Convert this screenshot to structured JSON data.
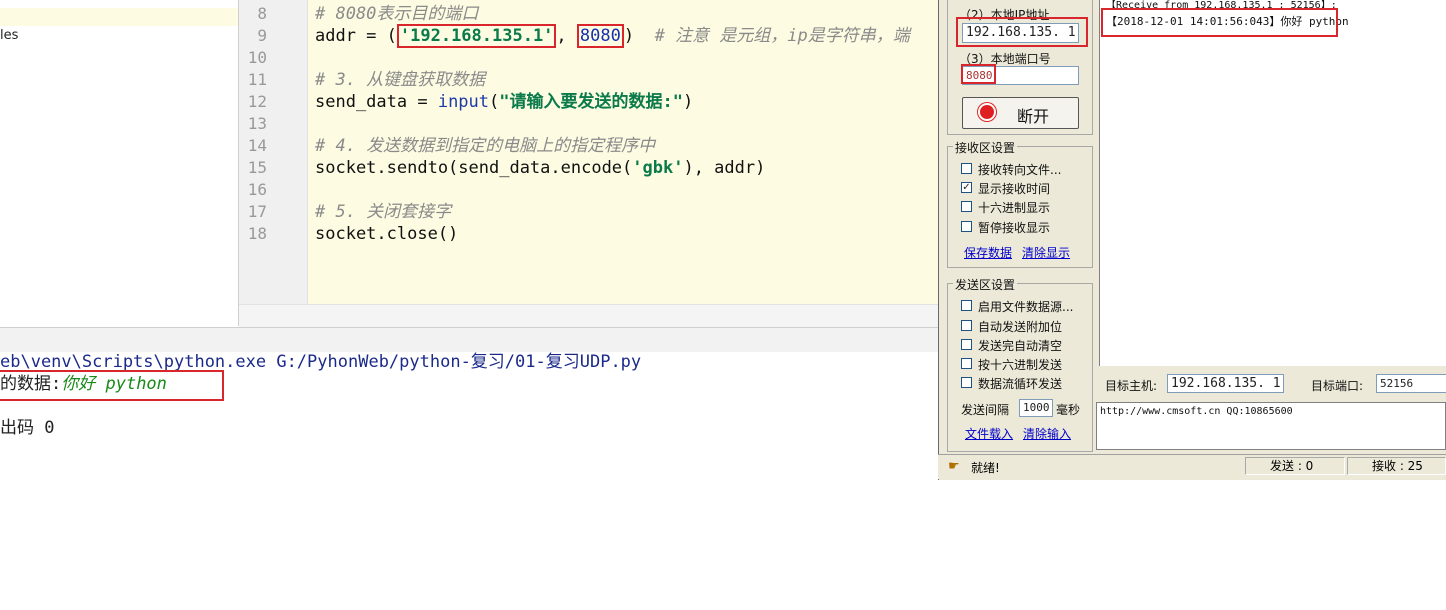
{
  "project": {
    "partial_item": "les"
  },
  "editor": {
    "line_numbers": [
      "8",
      "9",
      "10",
      "11",
      "12",
      "13",
      "14",
      "15",
      "16",
      "17",
      "18"
    ],
    "comment_8": "# 8080表示目的端口",
    "addr_prefix": "addr = (",
    "ip_string": "'192.168.135.1'",
    "sep": ", ",
    "port": "8080",
    "close_paren": ")",
    "comment_9": "  # 注意 是元组，ip是字符串，端",
    "comment_11": "# 3. 从键盘获取数据",
    "send_data_prefix": "send_data = ",
    "input_fn": "input",
    "input_open": "(",
    "input_prompt": "\"请输入要发送的数据:\"",
    "input_close": ")",
    "comment_14": "# 4. 发送数据到指定的电脑上的指定程序中",
    "sendto_prefix": "socket.sendto(send_data.encode(",
    "gbk_string": "'gbk'",
    "sendto_suffix": "), addr)",
    "comment_17": "# 5. 关闭套接字",
    "close_line": "socket.close()"
  },
  "console": {
    "command": "eb\\venv\\Scripts\\python.exe G:/PyhonWeb/python-复习/01-复习UDP.py",
    "prompt_tail": "的数据:",
    "user_input": "你好 python",
    "exit_text": "出码 0"
  },
  "udp_tool": {
    "local_ip_label": "（2）本地IP地址",
    "local_ip": "192.168.135. 1",
    "local_port_label": "（3）本地端口号",
    "local_port": "8080",
    "disconnect_label": "断开",
    "recv_group_title": "接收区设置",
    "recv_options": [
      {
        "label": "接收转向文件...",
        "checked": false
      },
      {
        "label": "显示接收时间",
        "checked": true
      },
      {
        "label": "十六进制显示",
        "checked": false
      },
      {
        "label": "暂停接收显示",
        "checked": false
      }
    ],
    "save_data": "保存数据",
    "clear_display": "清除显示",
    "send_group_title": "发送区设置",
    "send_options": [
      {
        "label": "启用文件数据源...",
        "checked": false
      },
      {
        "label": "自动发送附加位",
        "checked": false
      },
      {
        "label": "发送完自动清空",
        "checked": false
      },
      {
        "label": "按十六进制发送",
        "checked": false
      },
      {
        "label": "数据流循环发送",
        "checked": false
      }
    ],
    "interval_label": "发送间隔",
    "interval_value": "1000",
    "interval_unit": "毫秒",
    "file_load": "文件载入",
    "clear_input": "清除输入",
    "recv_header": "【Receive from 192.168.135.1 : 52156】:",
    "recv_message": "【2018-12-01 14:01:56:043】你好 python",
    "target_host_label": "目标主机:",
    "target_host": "192.168.135. 1",
    "target_port_label": "目标端口:",
    "target_port": "52156",
    "send_text": "http://www.cmsoft.cn QQ:10865600",
    "status_ready": "就绪!",
    "sent_count": "发送 : 0",
    "recv_count": "接收 : 25"
  },
  "colors": {
    "highlight_red": "#d8262c",
    "editor_bg": "#fdfbe2",
    "window_bg": "#ece9d8"
  }
}
